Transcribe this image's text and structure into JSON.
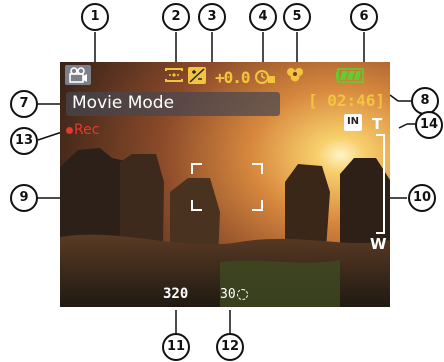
{
  "mode": {
    "label": "Movie Mode"
  },
  "rec": {
    "label": "Rec"
  },
  "exposure": {
    "value": "+0.0"
  },
  "time": {
    "value": "[ 02:46]"
  },
  "resolution": {
    "value": "320"
  },
  "framerate": {
    "value": "30"
  },
  "zoom": {
    "tele_label": "T",
    "wide_label": "W"
  },
  "memory": {
    "label": "IN"
  },
  "callouts": [
    "1",
    "2",
    "3",
    "4",
    "5",
    "6",
    "7",
    "8",
    "9",
    "10",
    "11",
    "12",
    "13",
    "14"
  ],
  "icons": [
    "movie-camera-icon",
    "metering-icon",
    "exposure-icon",
    "self-timer-icon",
    "macro-flower-icon",
    "battery-icon",
    "internal-memory-icon",
    "focus-frame-icon",
    "zoom-bar-icon"
  ],
  "colors": {
    "accent_yellow": "#f2c440",
    "rec_red": "#e23a2e",
    "battery_green": "#5ecf2e"
  }
}
